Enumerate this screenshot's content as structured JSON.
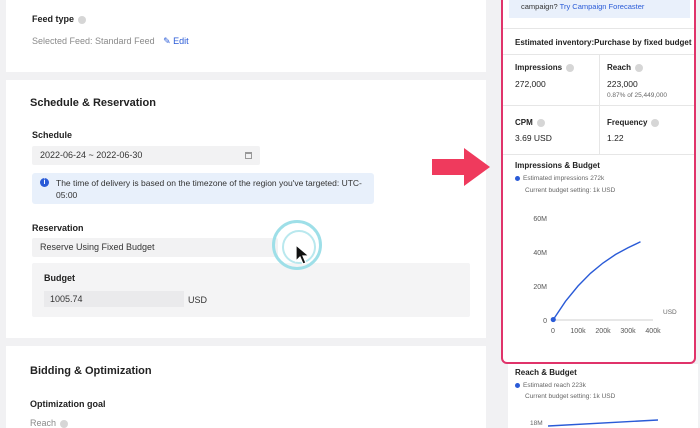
{
  "feed": {
    "label": "Feed type",
    "selected": "Selected Feed: Standard Feed",
    "edit": "Edit"
  },
  "schedule_section": {
    "title": "Schedule & Reservation",
    "schedule_label": "Schedule",
    "date_range": "2022-06-24 ~ 2022-06-30",
    "info": "The time of delivery is based on the timezone of the region you've targeted: UTC-05:00",
    "reservation_label": "Reservation",
    "reservation_value": "Reserve Using Fixed Budget",
    "budget_label": "Budget",
    "budget_value": "1005.74",
    "currency": "USD"
  },
  "bidding": {
    "title": "Bidding & Optimization",
    "goal_label": "Optimization goal",
    "goal_value": "Reach"
  },
  "panel": {
    "top_text": "campaign?",
    "top_link": "Try Campaign Forecaster",
    "estimate_title": "Estimated inventory:Purchase by fixed budget",
    "impressions_label": "Impressions",
    "impressions_value": "272,000",
    "reach_label": "Reach",
    "reach_value": "223,000",
    "reach_sub": "0.87% of 25,449,000",
    "cpm_label": "CPM",
    "cpm_value": "3.69 USD",
    "frequency_label": "Frequency",
    "frequency_value": "1.22",
    "chart_title": "Impressions & Budget",
    "legend": "Estimated impressions 272k",
    "budget_setting": "Current budget setting: 1k USD"
  },
  "below_panel": {
    "title": "Reach & Budget",
    "legend": "Estimated reach 223k",
    "budget_setting": "Current budget setting: 1k USD",
    "tick": "18M"
  },
  "chart_data": {
    "type": "line",
    "title": "Impressions & Budget",
    "xlabel": "USD",
    "ylabel": "",
    "x_ticks": [
      "0",
      "100k",
      "200k",
      "300k",
      "400k"
    ],
    "y_ticks": [
      "0",
      "20M",
      "40M",
      "60M"
    ],
    "xlim": [
      0,
      400000
    ],
    "ylim": [
      0,
      60000000
    ],
    "series": [
      {
        "name": "Estimated impressions 272k",
        "x": [
          0,
          50000,
          100000,
          150000,
          200000,
          250000,
          300000,
          350000
        ],
        "y": [
          0,
          11000000,
          20000000,
          27500000,
          33500000,
          38500000,
          42500000,
          46000000
        ]
      }
    ],
    "current_point": {
      "x": 1000,
      "y": 272000
    },
    "colors": {
      "line": "#2a5bd7"
    }
  },
  "colors": {
    "highlight_border": "#e0336a",
    "arrow": "#ef3a5d",
    "link": "#2a5bd7"
  }
}
